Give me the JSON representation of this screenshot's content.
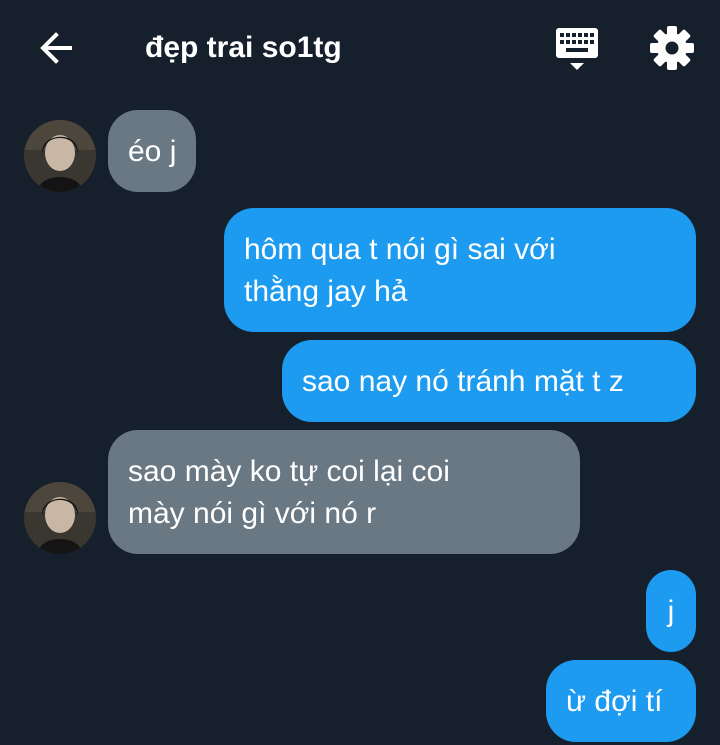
{
  "header": {
    "title": "đẹp trai so1tg",
    "back_icon": "arrow-left-icon",
    "keyboard_icon": "keyboard-icon",
    "settings_icon": "gear-icon"
  },
  "colors": {
    "background": "#16202c",
    "incoming_bubble": "#6a7884",
    "outgoing_bubble": "#1d9bf0",
    "text": "#ffffff"
  },
  "messages": [
    {
      "direction": "incoming",
      "lines": [
        "éo j"
      ]
    },
    {
      "direction": "outgoing",
      "lines": [
        "hôm qua t nói gì sai với",
        "thằng jay hả"
      ]
    },
    {
      "direction": "outgoing",
      "lines": [
        "sao nay nó tránh mặt t z"
      ]
    },
    {
      "direction": "incoming",
      "lines": [
        "sao mày ko tự coi lại coi",
        "mày nói gì với nó r"
      ]
    },
    {
      "direction": "outgoing",
      "lines": [
        "j"
      ]
    },
    {
      "direction": "outgoing",
      "lines": [
        "ừ đợi tí"
      ]
    }
  ]
}
